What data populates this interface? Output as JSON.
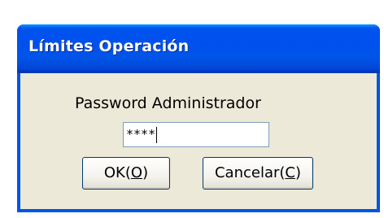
{
  "window": {
    "title": "Límites Operación"
  },
  "form": {
    "label": "Password Administrador",
    "password_value": "****"
  },
  "buttons": {
    "ok": {
      "label_prefix": "OK(",
      "mnemonic": "O",
      "label_suffix": ")"
    },
    "cancel": {
      "label_prefix": "Cancelar(",
      "mnemonic": "C",
      "label_suffix": ")"
    }
  },
  "colors": {
    "titlebar": "#0055e5",
    "dialog_background": "#ece9d8",
    "button_border": "#003c74",
    "input_border": "#7f9db9"
  }
}
